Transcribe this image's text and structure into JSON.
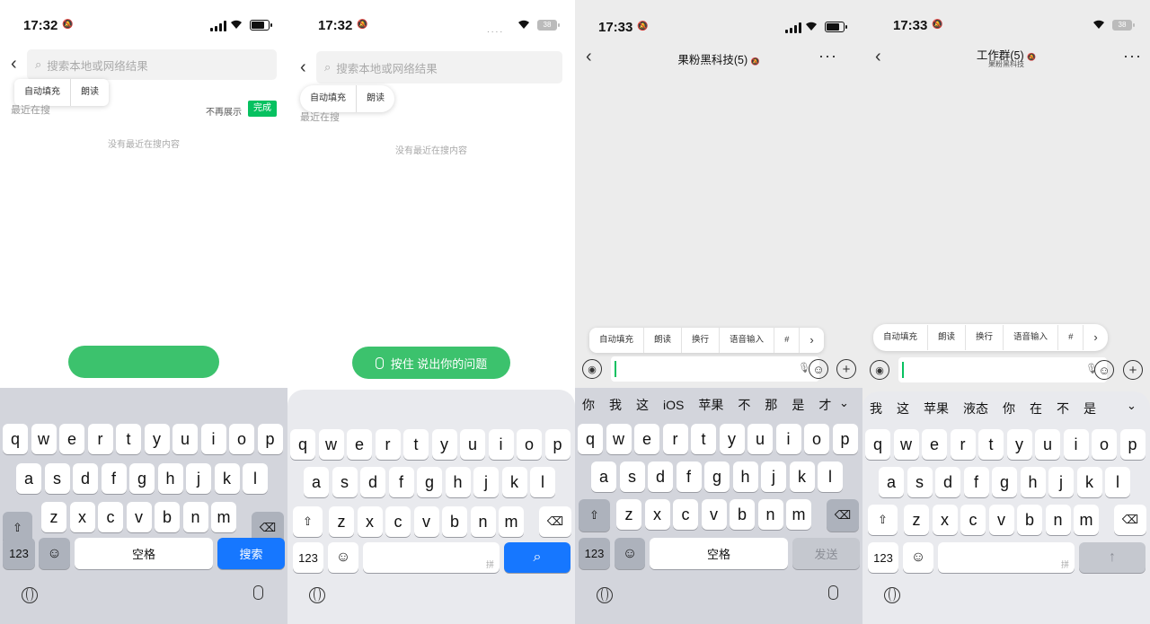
{
  "panels": [
    {
      "status": {
        "time": "17:32",
        "battery": ""
      },
      "search": {
        "placeholder": "搜索本地或网络结果"
      },
      "popup": [
        "自动填充",
        "朗读"
      ],
      "recent_label": "最近在搜",
      "no_show_label": "不再展示",
      "done_label": "完成",
      "empty_text": "没有最近在搜内容",
      "voice_button": {
        "label": ""
      },
      "keyboard": {
        "row1": [
          "q",
          "w",
          "e",
          "r",
          "t",
          "y",
          "u",
          "i",
          "o",
          "p"
        ],
        "row2": [
          "a",
          "s",
          "d",
          "f",
          "g",
          "h",
          "j",
          "k",
          "l"
        ],
        "row3": [
          "z",
          "x",
          "c",
          "v",
          "b",
          "n",
          "m"
        ],
        "num": "123",
        "space": "空格",
        "action": "搜索"
      }
    },
    {
      "status": {
        "time": "17:32",
        "battery": "38"
      },
      "search": {
        "placeholder": "搜索本地或网络结果"
      },
      "popup": [
        "自动填充",
        "朗读"
      ],
      "recent_label": "最近在搜",
      "empty_text": "没有最近在搜内容",
      "voice_button": {
        "label": "按住 说出你的问题"
      },
      "keyboard": {
        "row1": [
          "q",
          "w",
          "e",
          "r",
          "t",
          "y",
          "u",
          "i",
          "o",
          "p"
        ],
        "row2": [
          "a",
          "s",
          "d",
          "f",
          "g",
          "h",
          "j",
          "k",
          "l"
        ],
        "row3": [
          "z",
          "x",
          "c",
          "v",
          "b",
          "n",
          "m"
        ],
        "num": "123",
        "space_hint": "拼"
      }
    },
    {
      "status": {
        "time": "17:33",
        "battery": ""
      },
      "chat": {
        "title": "果粉黑科技(5)",
        "subtitle": ""
      },
      "toolbar": [
        "自动填充",
        "朗读",
        "换行",
        "语音输入",
        "#",
        "›"
      ],
      "candidates": [
        "你",
        "我",
        "这",
        "iOS",
        "苹果",
        "不",
        "那",
        "是",
        "才"
      ],
      "keyboard": {
        "row1": [
          "q",
          "w",
          "e",
          "r",
          "t",
          "y",
          "u",
          "i",
          "o",
          "p"
        ],
        "row2": [
          "a",
          "s",
          "d",
          "f",
          "g",
          "h",
          "j",
          "k",
          "l"
        ],
        "row3": [
          "z",
          "x",
          "c",
          "v",
          "b",
          "n",
          "m"
        ],
        "num": "123",
        "space": "空格",
        "action": "发送"
      }
    },
    {
      "status": {
        "time": "17:33",
        "battery": "38"
      },
      "chat": {
        "title": "工作群(5)",
        "subtitle": "果粉黑科技"
      },
      "toolbar": [
        "自动填充",
        "朗读",
        "换行",
        "语音输入",
        "#",
        "›"
      ],
      "candidates": [
        "我",
        "这",
        "苹果",
        "液态",
        "你",
        "在",
        "不",
        "是"
      ],
      "keyboard": {
        "row1": [
          "q",
          "w",
          "e",
          "r",
          "t",
          "y",
          "u",
          "i",
          "o",
          "p"
        ],
        "row2": [
          "a",
          "s",
          "d",
          "f",
          "g",
          "h",
          "j",
          "k",
          "l"
        ],
        "row3": [
          "z",
          "x",
          "c",
          "v",
          "b",
          "n",
          "m"
        ],
        "num": "123",
        "space_hint": "拼",
        "action": "↑"
      }
    }
  ],
  "icons": {
    "back": "chevron-left-icon",
    "search": "search-icon",
    "more": "more-icon",
    "voice": "voice-icon",
    "emoji": "emoji-icon",
    "plus": "plus-icon",
    "globe": "globe-icon",
    "mic": "mic-icon",
    "shift": "shift-icon",
    "backspace": "backspace-icon"
  },
  "colors": {
    "wechat_green": "#07c160",
    "voice_green": "#3cc26d",
    "ios_blue": "#1677ff"
  }
}
